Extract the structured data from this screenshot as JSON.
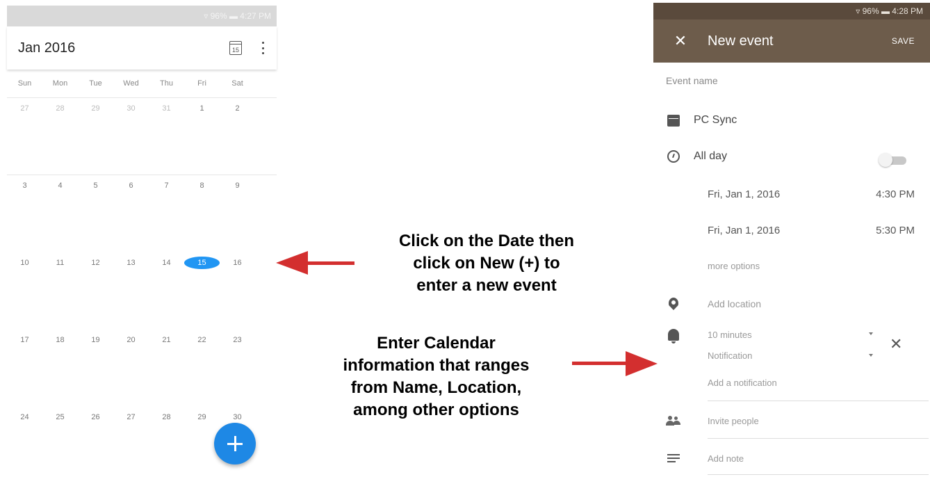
{
  "calendar": {
    "status": "▿ 96% ▬ 4:27 PM",
    "month_title": "Jan 2016",
    "today_icon_label": "15",
    "weekdays": [
      "Sun",
      "Mon",
      "Tue",
      "Wed",
      "Thu",
      "Fri",
      "Sat"
    ],
    "weeks": [
      [
        "27",
        "28",
        "29",
        "30",
        "31",
        "1",
        "2"
      ],
      [
        "3",
        "4",
        "5",
        "6",
        "7",
        "8",
        "9"
      ],
      [
        "10",
        "11",
        "12",
        "13",
        "14",
        "15",
        "16"
      ],
      [
        "17",
        "18",
        "19",
        "20",
        "21",
        "22",
        "23"
      ],
      [
        "24",
        "25",
        "26",
        "27",
        "28",
        "29",
        "30"
      ]
    ],
    "selected_day": "15",
    "fab_icon": "plus-icon",
    "accent_color": "#1e88e5"
  },
  "annotations": {
    "first": "Click on the Date then\nclick on New (+) to\nenter a new event",
    "second": "Enter Calendar\ninformation that ranges\nfrom Name, Location,\namong other options",
    "arrow_color": "#d32f2f"
  },
  "new_event": {
    "status": "▿ 96% ▬ 4:28 PM",
    "close_label": "✕",
    "title": "New event",
    "save_label": "SAVE",
    "toolbar_color": "#6d5c4b",
    "event_name_placeholder": "Event name",
    "calendar_name": "PC Sync",
    "all_day_label": "All day",
    "all_day_on": false,
    "start_date": "Fri, Jan 1, 2016",
    "start_time": "4:30 PM",
    "end_date": "Fri, Jan 1, 2016",
    "end_time": "5:30 PM",
    "more_options": "more options",
    "location_placeholder": "Add location",
    "notification_time": "10 minutes",
    "notification_type": "Notification",
    "remove_notification": "✕",
    "add_notification": "Add a notification",
    "invite_people": "Invite people",
    "add_note": "Add note"
  }
}
